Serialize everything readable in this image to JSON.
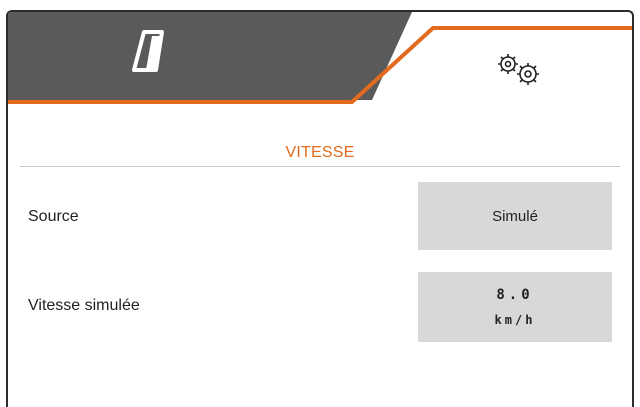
{
  "tabs": [
    {
      "icon": "field-icon",
      "active": false
    },
    {
      "icon": "gears-icon",
      "active": true
    }
  ],
  "section": {
    "title": "VITESSE"
  },
  "rows": [
    {
      "label": "Source",
      "value": "Simulé"
    },
    {
      "label": "Vitesse simulée",
      "value": "8.0",
      "unit": "km/h"
    }
  ],
  "colors": {
    "accent": "#e36b1f",
    "tab_inactive": "#5a5a5a",
    "button": "#d8d8d8"
  }
}
